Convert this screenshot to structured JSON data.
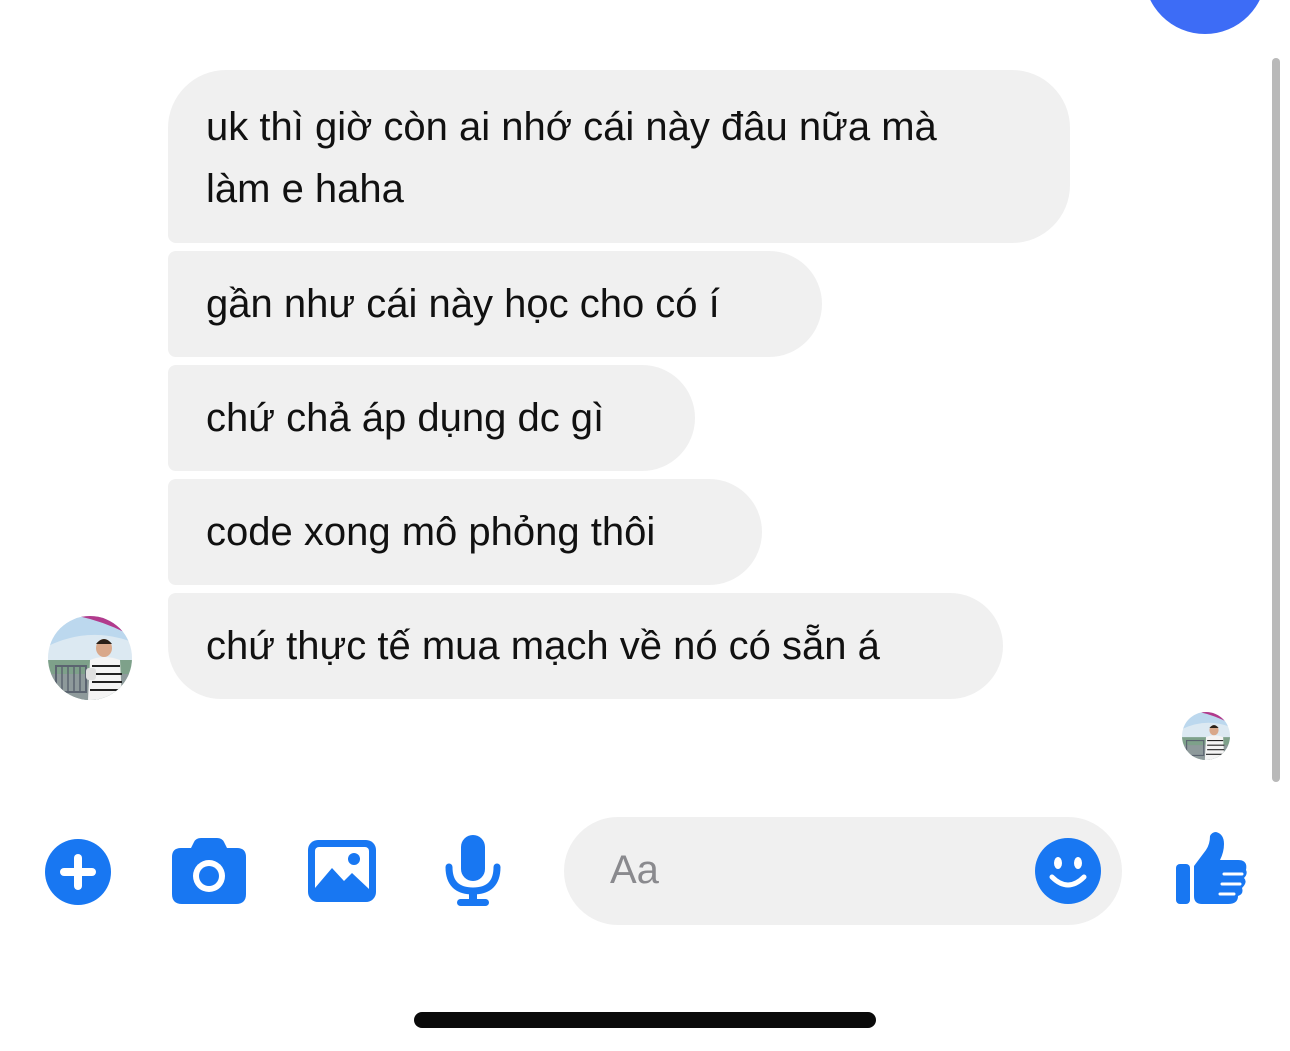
{
  "colors": {
    "accent": "#1877f2",
    "bubble": "#f0f0f0",
    "text": "#111111",
    "placeholder": "#8a8a8e",
    "top_blob": "#3d6cf6"
  },
  "messages": [
    {
      "lines": [
        "uk thì giờ còn ai nhớ cái này đâu nữa mà",
        "làm e haha"
      ]
    },
    {
      "lines": [
        "gần như cái này học cho có í"
      ]
    },
    {
      "lines": [
        "chứ chả áp dụng dc gì"
      ]
    },
    {
      "lines": [
        "code xong mô phỏng thôi"
      ]
    },
    {
      "lines": [
        "chứ thực tế mua mạch về nó có sẵn á"
      ]
    }
  ],
  "icons": {
    "sender_avatar": "avatar",
    "seen_avatar": "seen-avatar",
    "plus": "plus-circle-icon",
    "camera": "camera-icon",
    "gallery": "image-icon",
    "mic": "microphone-icon",
    "emoji": "smiley-icon",
    "like": "thumbs-up-icon"
  },
  "composer": {
    "placeholder": "Aa",
    "value": ""
  }
}
